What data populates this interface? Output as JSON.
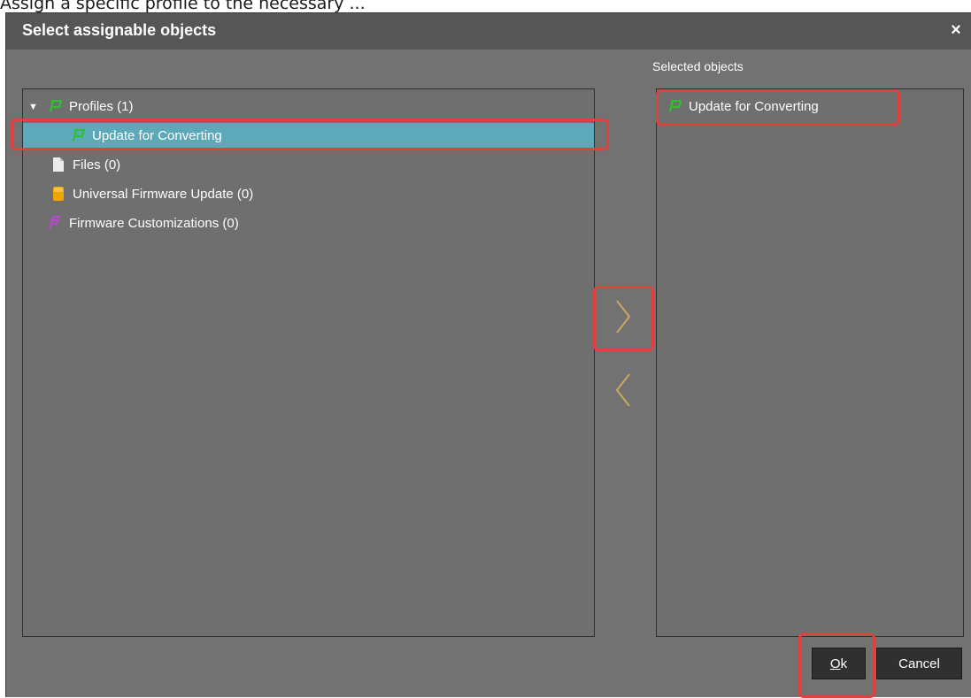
{
  "page_strip_text": "Assign a specific profile to the necessary ...",
  "dialog": {
    "title": "Select assignable objects",
    "close_glyph": "×"
  },
  "selected_objects_label": "Selected objects",
  "tree": {
    "items": [
      {
        "label": "Profiles (1)",
        "icon": "profile-icon",
        "expanded": true
      },
      {
        "label": "Update for Converting",
        "icon": "profile-icon",
        "selected": true
      },
      {
        "label": "Files (0)",
        "icon": "file-icon"
      },
      {
        "label": "Universal Firmware Update (0)",
        "icon": "firmware-update-icon"
      },
      {
        "label": "Firmware Customizations (0)",
        "icon": "firmware-customization-icon"
      }
    ]
  },
  "selected_list": {
    "items": [
      {
        "label": "Update for Converting",
        "icon": "profile-icon"
      }
    ]
  },
  "transfer": {
    "add_icon": "chevron-right-icon",
    "remove_icon": "chevron-left-icon"
  },
  "buttons": {
    "ok_mnemonic": "O",
    "ok_rest": "k",
    "cancel": "Cancel"
  },
  "colors": {
    "dialog_bg": "#727272",
    "titlebar_bg": "#565656",
    "selection": "#5ea9b9",
    "highlight": "#e2403d",
    "arrow": "#c8a860",
    "profile_icon": "#2fbf2f"
  }
}
